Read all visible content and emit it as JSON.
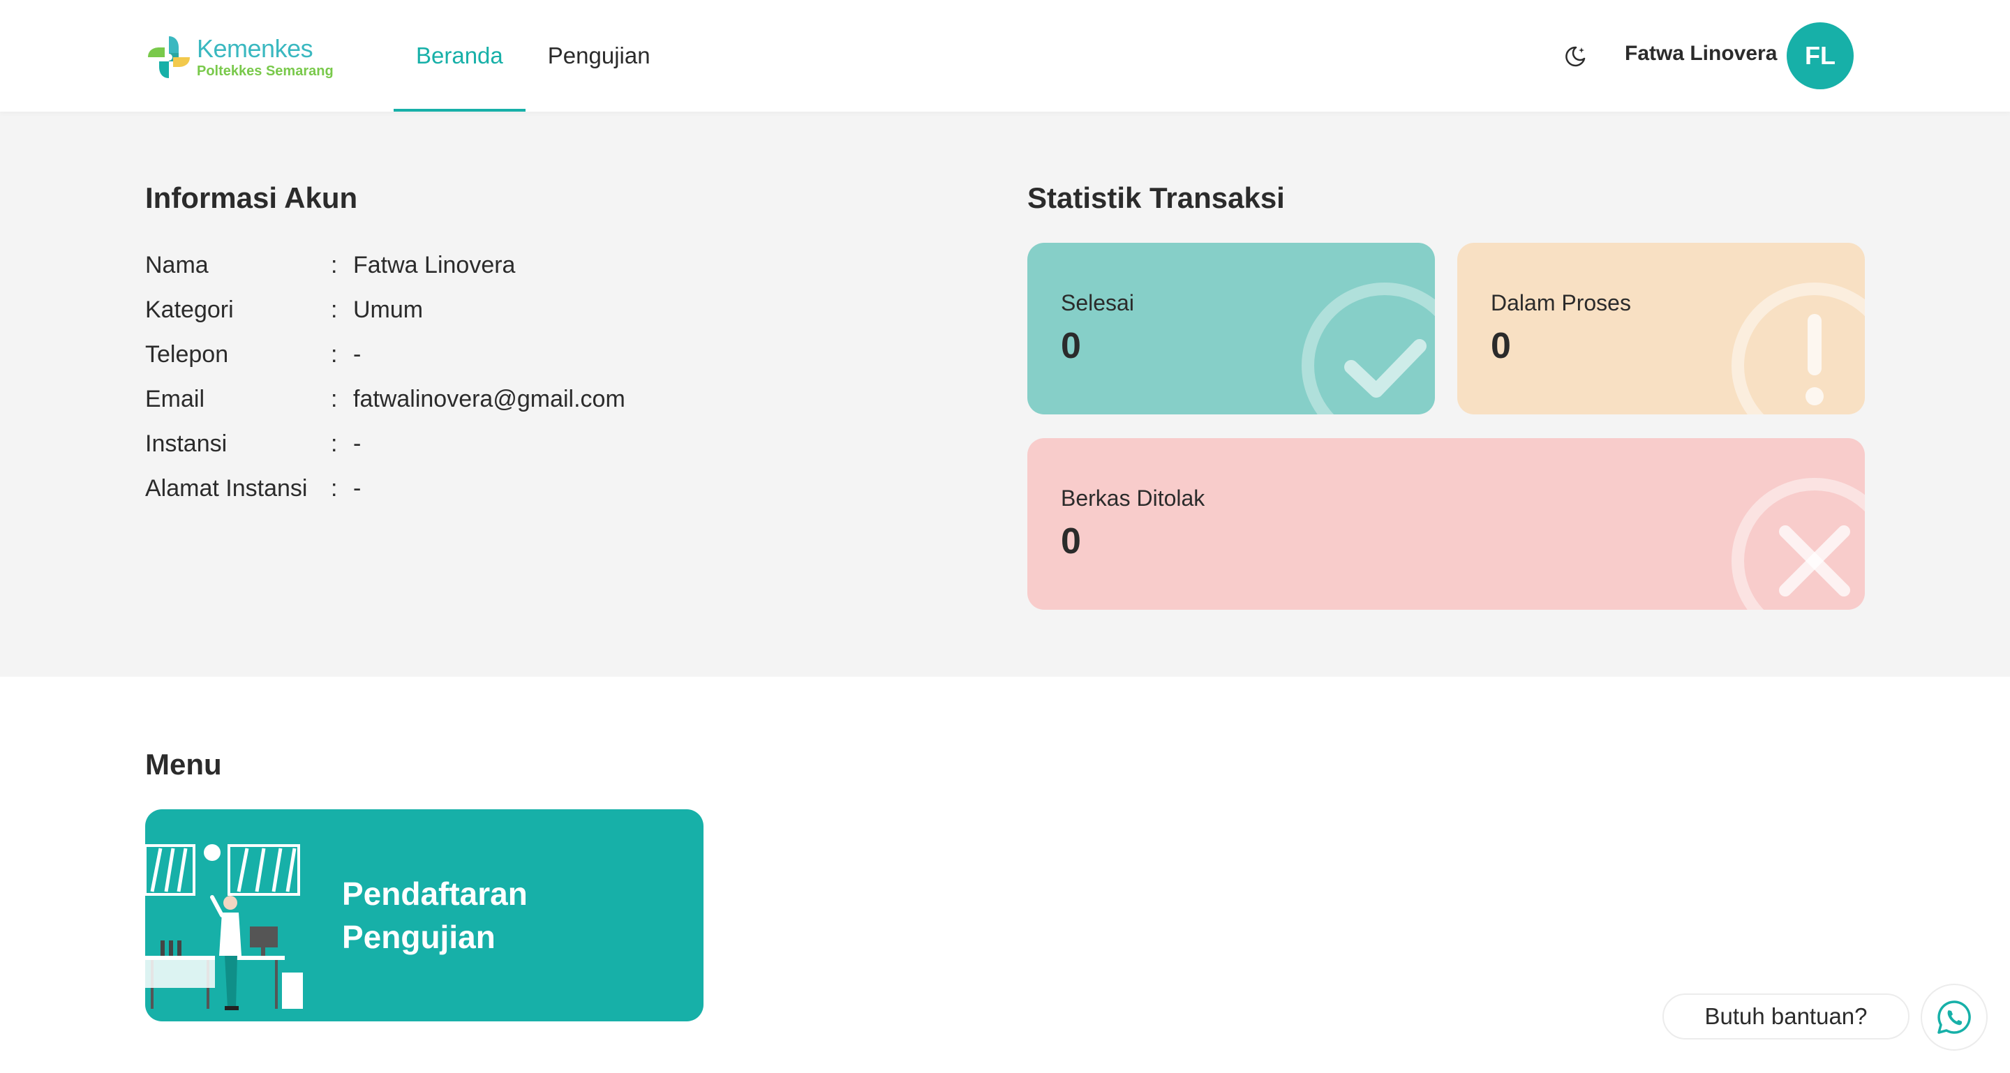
{
  "header": {
    "logo_title": "Kemenkes",
    "logo_subtitle": "Poltekkes Semarang",
    "nav": [
      {
        "label": "Beranda",
        "active": true
      },
      {
        "label": "Pengujian",
        "active": false
      }
    ],
    "theme_icon": "moon-icon",
    "user_name": "Fatwa Linovera",
    "avatar_initials": "FL"
  },
  "account": {
    "title": "Informasi Akun",
    "rows": [
      {
        "label": "Nama",
        "value": "Fatwa Linovera"
      },
      {
        "label": "Kategori",
        "value": "Umum"
      },
      {
        "label": "Telepon",
        "value": "-"
      },
      {
        "label": "Email",
        "value": "fatwalinovera@gmail.com"
      },
      {
        "label": "Instansi",
        "value": "-"
      },
      {
        "label": "Alamat Instansi",
        "value": "-"
      }
    ]
  },
  "stats": {
    "title": "Statistik Transaksi",
    "cards": [
      {
        "label": "Selesai",
        "value": "0",
        "color": "#86cfc8",
        "icon": "check-icon"
      },
      {
        "label": "Dalam Proses",
        "value": "0",
        "color": "#f8e0c3",
        "icon": "exclamation-icon"
      },
      {
        "label": "Berkas Ditolak",
        "value": "0",
        "color": "#f8cccb",
        "icon": "x-icon"
      }
    ]
  },
  "menu": {
    "title": "Menu",
    "items": [
      {
        "label": "Pendaftaran Pengujian"
      }
    ]
  },
  "help": {
    "label": "Butuh bantuan?",
    "icon": "whatsapp-icon"
  },
  "colors": {
    "primary": "#17b0a8",
    "gray_bg": "#f4f4f4"
  }
}
